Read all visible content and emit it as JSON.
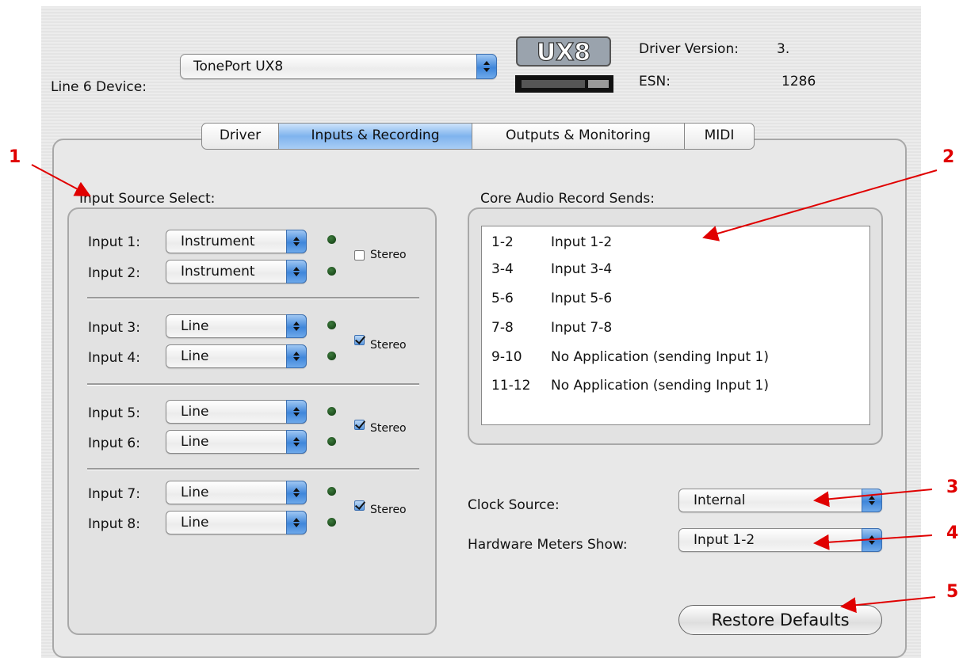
{
  "device": {
    "label": "Line 6 Device:",
    "value": "TonePort UX8"
  },
  "logo_text": "UX8",
  "driver_version": {
    "label": "Driver Version:",
    "value": "3."
  },
  "esn": {
    "label": "ESN:",
    "value": "1286"
  },
  "tabs": [
    {
      "label": "Driver",
      "active": false
    },
    {
      "label": "Inputs & Recording",
      "active": true
    },
    {
      "label": "Outputs & Monitoring",
      "active": false
    },
    {
      "label": "MIDI",
      "active": false
    }
  ],
  "input_source": {
    "title": "Input Source Select:",
    "inputs": [
      {
        "label": "Input 1:",
        "value": "Instrument"
      },
      {
        "label": "Input 2:",
        "value": "Instrument"
      },
      {
        "label": "Input 3:",
        "value": "Line"
      },
      {
        "label": "Input 4:",
        "value": "Line"
      },
      {
        "label": "Input 5:",
        "value": "Line"
      },
      {
        "label": "Input 6:",
        "value": "Line"
      },
      {
        "label": "Input 7:",
        "value": "Line"
      },
      {
        "label": "Input 8:",
        "value": "Line"
      }
    ],
    "stereo": [
      {
        "label": "Stereo",
        "checked": false
      },
      {
        "label": "Stereo",
        "checked": true
      },
      {
        "label": "Stereo",
        "checked": true
      },
      {
        "label": "Stereo",
        "checked": true
      }
    ]
  },
  "record_sends": {
    "title": "Core Audio Record Sends:",
    "rows": [
      {
        "channels": "1-2",
        "source": "Input 1-2"
      },
      {
        "channels": "3-4",
        "source": "Input 3-4"
      },
      {
        "channels": "5-6",
        "source": "Input 5-6"
      },
      {
        "channels": "7-8",
        "source": "Input 7-8"
      },
      {
        "channels": "9-10",
        "source": "No Application (sending Input 1)"
      },
      {
        "channels": "11-12",
        "source": "No Application (sending Input 1)"
      }
    ]
  },
  "clock_source": {
    "label": "Clock Source:",
    "value": "Internal"
  },
  "hardware_meters": {
    "label": "Hardware Meters Show:",
    "value": "Input 1-2"
  },
  "restore_defaults": "Restore Defaults",
  "callouts": [
    "1",
    "2",
    "3",
    "4",
    "5"
  ],
  "colors": {
    "accent": "#3f86da",
    "callout": "#e00000",
    "led": "#1f5a1f"
  }
}
